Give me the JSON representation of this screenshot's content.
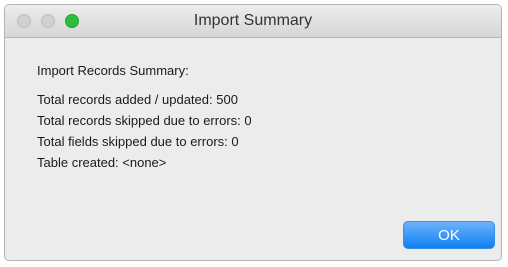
{
  "window": {
    "title": "Import Summary"
  },
  "summary": {
    "heading": "Import Records Summary:",
    "lines": [
      "Total records added / updated: 500",
      "Total records skipped due to errors: 0",
      "Total fields skipped due to errors: 0",
      "Table created: <none>"
    ]
  },
  "buttons": {
    "ok_label": "OK"
  },
  "colors": {
    "accent": "#1a86f5",
    "zoom_button": "#2ebd3c",
    "inactive_button": "#d0d0d0"
  }
}
